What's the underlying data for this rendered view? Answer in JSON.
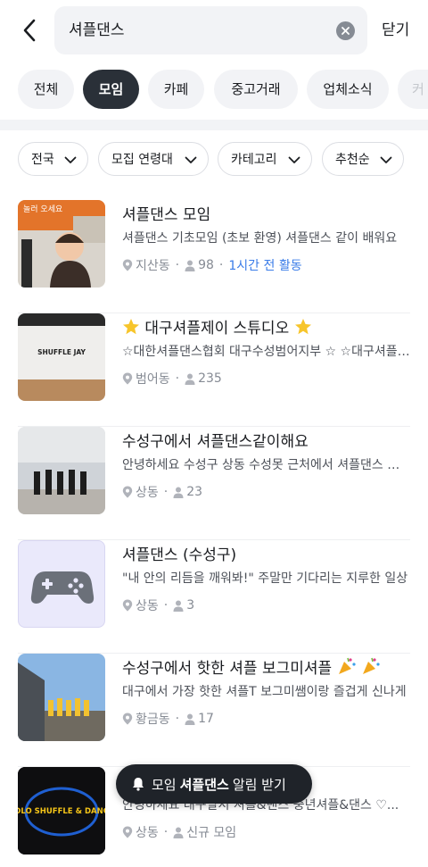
{
  "search": {
    "query": "셔플댄스",
    "close_label": "닫기"
  },
  "tabs": [
    {
      "label": "전체"
    },
    {
      "label": "모임"
    },
    {
      "label": "카페"
    },
    {
      "label": "중고거래"
    },
    {
      "label": "업체소식"
    },
    {
      "label": "커"
    }
  ],
  "filters": [
    {
      "label": "전국"
    },
    {
      "label": "모집 연령대"
    },
    {
      "label": "카테고리"
    },
    {
      "label": "추천순"
    }
  ],
  "results": [
    {
      "title": "셔플댄스 모임",
      "desc": "셔플댄스 기초모임 (초보 환영) 셔플댄스 같이 배워요",
      "location": "지산동",
      "members": "98",
      "activity": "1시간 전 활동",
      "thumb_text": "놀러 오세요"
    },
    {
      "title": "대구셔플제이 스튜디오",
      "desc": "☆대한셔플댄스협회 대구수성범어지부 ☆ ☆대구셔플제이",
      "location": "범어동",
      "members": "235",
      "thumb_text": "SHUFFLE JAY"
    },
    {
      "title": "수성구에서 셔플댄스같이해요",
      "desc": "안녕하세요 수성구 상동 수성못 근처에서 셔플댄스 같이 해요",
      "location": "상동",
      "members": "23"
    },
    {
      "title": "셔플댄스 (수성구)",
      "desc": "\"내 안의 리듬을 깨워봐!\" 주말만 기다리는 지루한 일상",
      "location": "상동",
      "members": "3"
    },
    {
      "title": "수성구에서 핫한 셔플 보그미셔플",
      "desc": "대구에서 가장 핫한 셔플T 보그미쌤이랑 즐겁게 신나게",
      "location": "황금동",
      "members": "17"
    },
    {
      "title": "",
      "desc": "안녕하세요 대구달서 셔플&댄스 중년셔플&댄스 ♡...",
      "location": "상동",
      "members": "신규 모임",
      "thumb_text": "YOLO SHUFFLE & DANCE"
    }
  ],
  "banner": {
    "prefix": "모임",
    "keyword": "셔플댄스",
    "suffix": "알림 받기"
  },
  "colors": {
    "accent": "#3a7ce8",
    "active_tab": "#2a3038"
  }
}
